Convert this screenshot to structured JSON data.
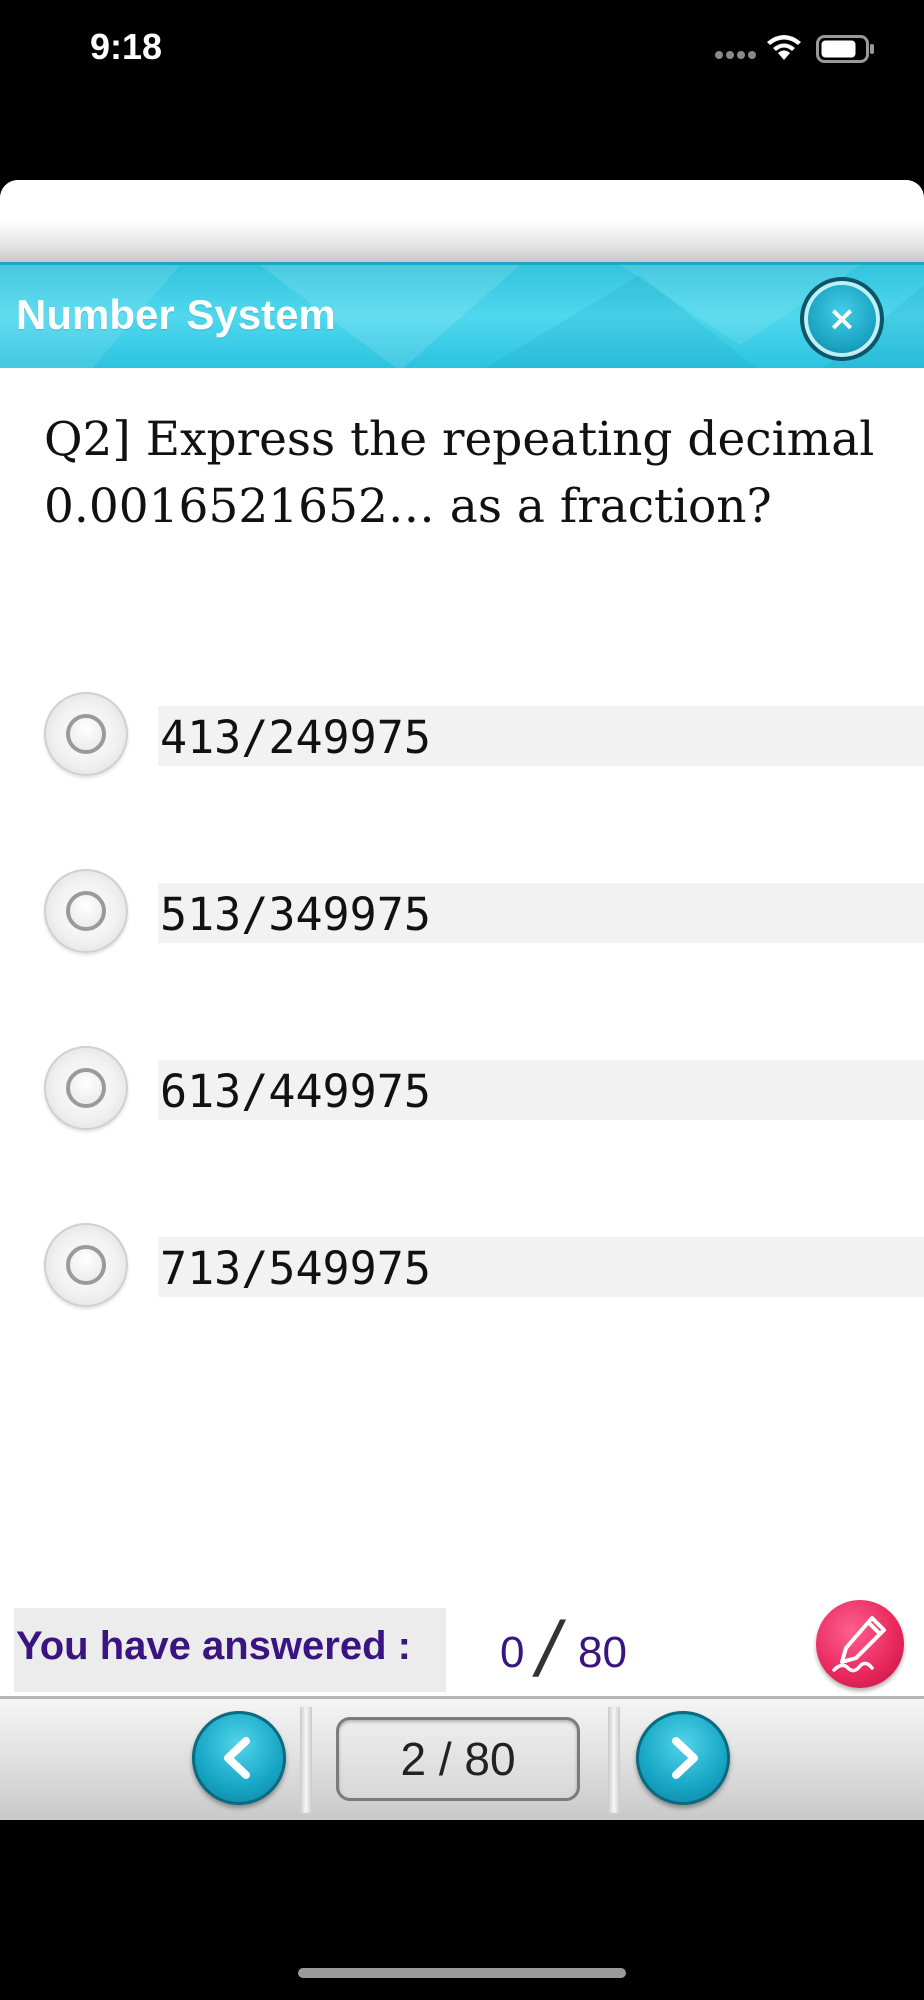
{
  "status_bar": {
    "time": "9:18"
  },
  "header": {
    "title": "Number System"
  },
  "question": {
    "text": "Q2]    Express the repeating decimal 0.0016521652… as a fraction?"
  },
  "options": [
    {
      "label": "413/249975"
    },
    {
      "label": "513/349975"
    },
    {
      "label": "613/449975"
    },
    {
      "label": "713/549975"
    }
  ],
  "progress": {
    "label": "You have answered :",
    "answered": "0",
    "total": "80"
  },
  "navigation": {
    "page": "2 / 80"
  },
  "colors": {
    "header": "#33c4dd",
    "accent_purple": "#3a1582",
    "pen_button": "#e8265b"
  }
}
